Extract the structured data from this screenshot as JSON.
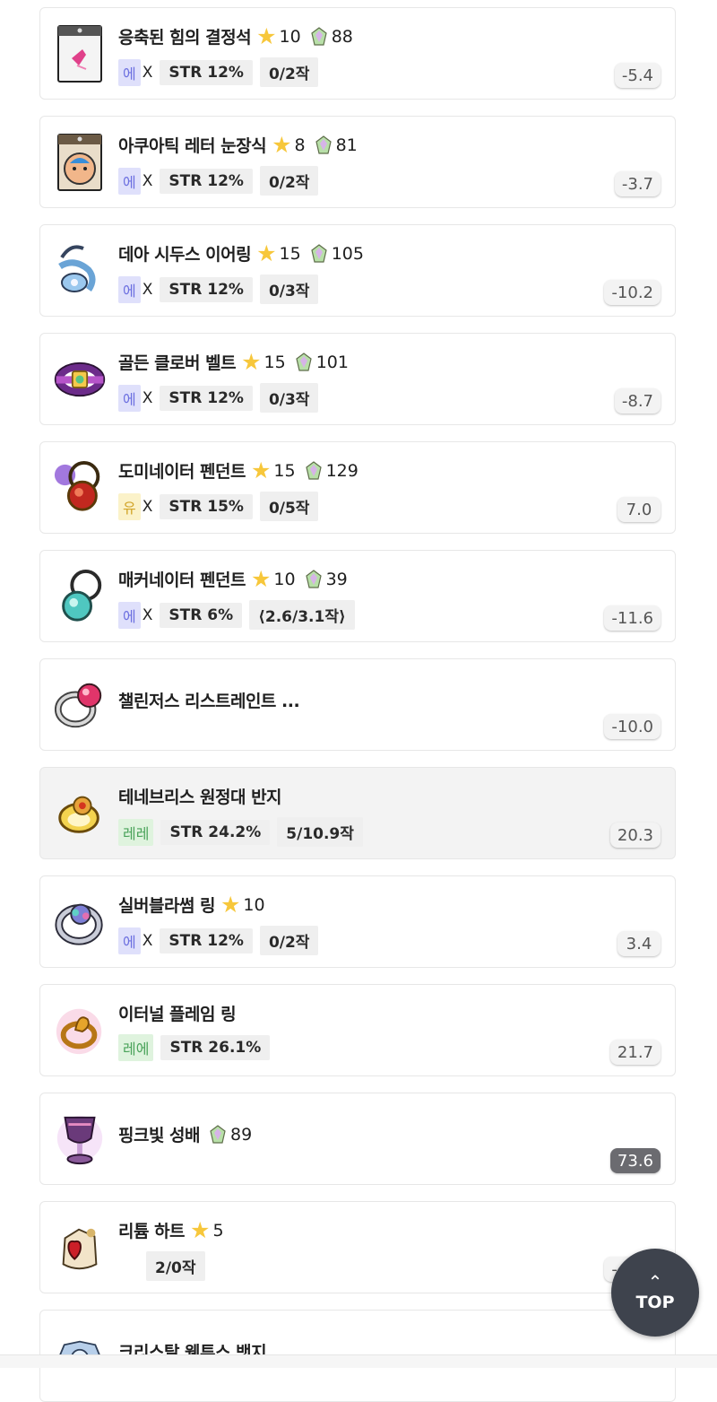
{
  "items": [
    {
      "name": "응축된 힘의 결정석",
      "stars": "10",
      "level": "88",
      "grade": "에",
      "grade_class": "g-epic",
      "has_x": true,
      "stat": "STR 12%",
      "scroll": "0/2작",
      "score": "-5.4",
      "icon": "crystal-icon",
      "highlight": false,
      "dark_score": false
    },
    {
      "name": "아쿠아틱 레터 눈장식",
      "stars": "8",
      "level": "81",
      "grade": "에",
      "grade_class": "g-epic",
      "has_x": true,
      "stat": "STR 12%",
      "scroll": "0/2작",
      "score": "-3.7",
      "icon": "eye-accessory-icon",
      "highlight": false,
      "dark_score": false
    },
    {
      "name": "데아 시두스 이어링",
      "stars": "15",
      "level": "105",
      "grade": "에",
      "grade_class": "g-epic",
      "has_x": true,
      "stat": "STR 12%",
      "scroll": "0/3작",
      "score": "-10.2",
      "icon": "earring-icon",
      "highlight": false,
      "dark_score": false
    },
    {
      "name": "골든 클로버 벨트",
      "stars": "15",
      "level": "101",
      "grade": "에",
      "grade_class": "g-epic",
      "has_x": true,
      "stat": "STR 12%",
      "scroll": "0/3작",
      "score": "-8.7",
      "icon": "belt-icon",
      "highlight": false,
      "dark_score": false
    },
    {
      "name": "도미네이터 펜던트",
      "stars": "15",
      "level": "129",
      "grade": "유",
      "grade_class": "g-unique",
      "has_x": true,
      "stat": "STR 15%",
      "scroll": "0/5작",
      "score": "7.0",
      "icon": "pendant-red-icon",
      "highlight": false,
      "dark_score": false
    },
    {
      "name": "매커네이터 펜던트",
      "stars": "10",
      "level": "39",
      "grade": "에",
      "grade_class": "g-epic",
      "has_x": true,
      "stat": "STR 6%",
      "scroll": "⟨2.6/3.1작⟩",
      "score": "-11.6",
      "icon": "pendant-teal-icon",
      "highlight": false,
      "dark_score": false
    },
    {
      "name": "챌린저스 리스트레인트 ...",
      "stars": "",
      "level": "",
      "grade": "",
      "grade_class": "",
      "has_x": false,
      "stat": "",
      "scroll": "",
      "score": "-10.0",
      "icon": "ring-icon",
      "highlight": false,
      "dark_score": false
    },
    {
      "name": "테네브리스 원정대 반지",
      "stars": "",
      "level": "",
      "grade": "레레",
      "grade_class": "g-legend",
      "has_x": false,
      "stat": "STR 24.2%",
      "scroll": "5/10.9작",
      "score": "20.3",
      "icon": "gold-ring-icon",
      "highlight": true,
      "dark_score": false
    },
    {
      "name": "실버블라썸 링",
      "stars": "10",
      "level": "",
      "grade": "에",
      "grade_class": "g-epic",
      "has_x": true,
      "stat": "STR 12%",
      "scroll": "0/2작",
      "score": "3.4",
      "icon": "silver-ring-icon",
      "highlight": false,
      "dark_score": false
    },
    {
      "name": "이터널 플레임 링",
      "stars": "",
      "level": "",
      "grade": "레에",
      "grade_class": "g-legend",
      "has_x": false,
      "stat": "STR 26.1%",
      "scroll": "",
      "score": "21.7",
      "icon": "flame-ring-icon",
      "highlight": false,
      "dark_score": false
    },
    {
      "name": "핑크빛 성배",
      "stars": "",
      "level": "89",
      "grade": "",
      "grade_class": "",
      "has_x": false,
      "stat": "",
      "scroll": "",
      "score": "73.6",
      "icon": "chalice-icon",
      "highlight": false,
      "dark_score": true
    },
    {
      "name": "리튬 하트",
      "stars": "5",
      "level": "",
      "grade": "",
      "grade_class": "",
      "has_x": false,
      "stat": "",
      "scroll": "2/0작",
      "score": "-48.4",
      "icon": "heart-icon",
      "highlight": false,
      "dark_score": false
    },
    {
      "name": "크리스탈 웬투스 뱃지",
      "stars": "",
      "level": "",
      "grade": "",
      "grade_class": "",
      "has_x": false,
      "stat": "",
      "scroll": "",
      "score": "",
      "icon": "badge-icon",
      "highlight": false,
      "dark_score": false
    }
  ],
  "x_label": "X",
  "top_button": {
    "arrow": "⌃",
    "label": "TOP"
  },
  "colors": {
    "epic": "#6c6fe0",
    "unique": "#d2a52a",
    "legendary": "#4aa35a",
    "star": "#f7c73b",
    "top_button": "#3e434d"
  }
}
